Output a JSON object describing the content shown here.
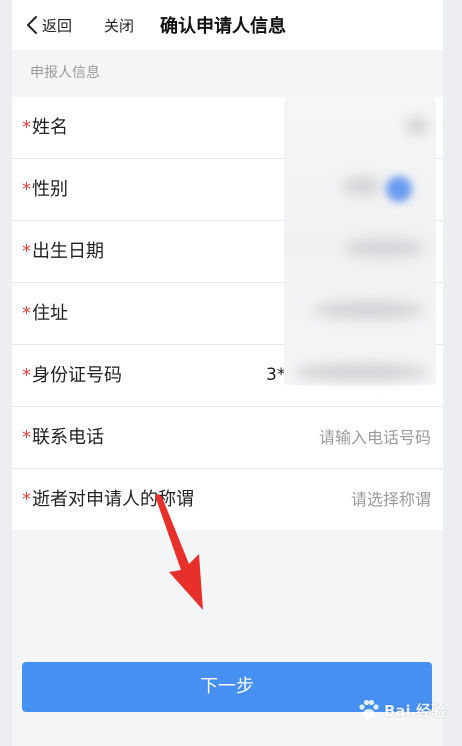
{
  "header": {
    "back_label": "返回",
    "close_label": "关闭",
    "title": "确认申请人信息"
  },
  "section": {
    "label": "申报人信息"
  },
  "form": {
    "required_mark": "*",
    "rows": [
      {
        "label": "姓名",
        "value": ""
      },
      {
        "label": "性别",
        "value": ""
      },
      {
        "label": "出生日期",
        "value": ""
      },
      {
        "label": "住址",
        "value": ""
      },
      {
        "label": "身份证号码",
        "value": "3*"
      },
      {
        "label": "联系电话",
        "placeholder": "请输入电话号码"
      },
      {
        "label": "逝者对申请人的称谓",
        "placeholder": "请选择称谓"
      }
    ]
  },
  "next_button": {
    "label": "下一步"
  },
  "watermark": {
    "text": "Bai 经验"
  },
  "colors": {
    "primary": "#4590f0",
    "required": "#e8453c",
    "annotation_arrow": "#e8302a"
  }
}
